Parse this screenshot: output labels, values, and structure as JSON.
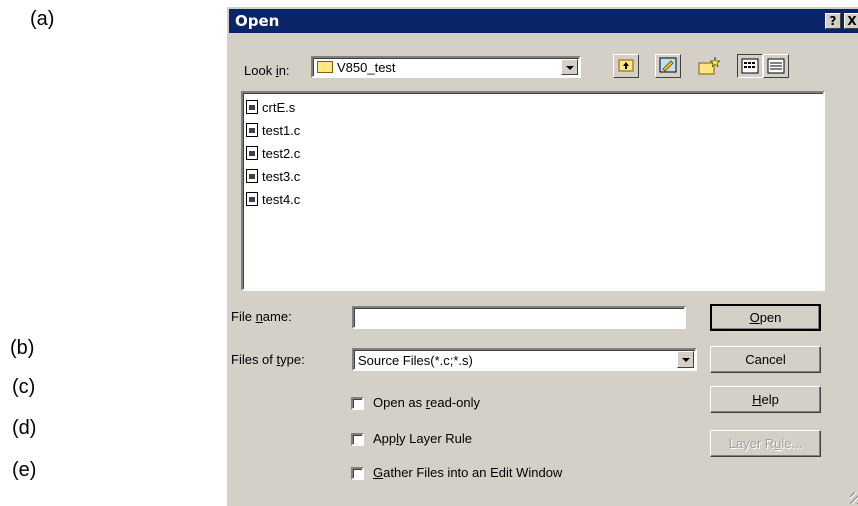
{
  "annotations": [
    "(a)",
    "(b)",
    "(c)",
    "(d)",
    "(e)"
  ],
  "dialog": {
    "title": "Open",
    "help_btn": "?",
    "close_btn": "X",
    "look_in_label": "Look in:",
    "look_in_value": "V850_test",
    "files": [
      "crtE.s",
      "test1.c",
      "test2.c",
      "test3.c",
      "test4.c"
    ],
    "file_name_label": "File name:",
    "file_name_value": "",
    "files_of_type_label": "Files of type:",
    "files_of_type_value": "Source Files(*.c;*.s)",
    "buttons": {
      "open": "Open",
      "cancel": "Cancel",
      "help": "Help",
      "layer_rule": "Layer Rule..."
    },
    "checkboxes": [
      {
        "label": "Open as read-only",
        "checked": false
      },
      {
        "label": "Apply Layer Rule",
        "checked": false
      },
      {
        "label": "Gather Files into an Edit Window",
        "checked": false
      }
    ]
  },
  "icons": [
    "up-one-level-icon",
    "desktop-icon",
    "new-folder-icon",
    "list-view-icon",
    "details-view-icon"
  ]
}
